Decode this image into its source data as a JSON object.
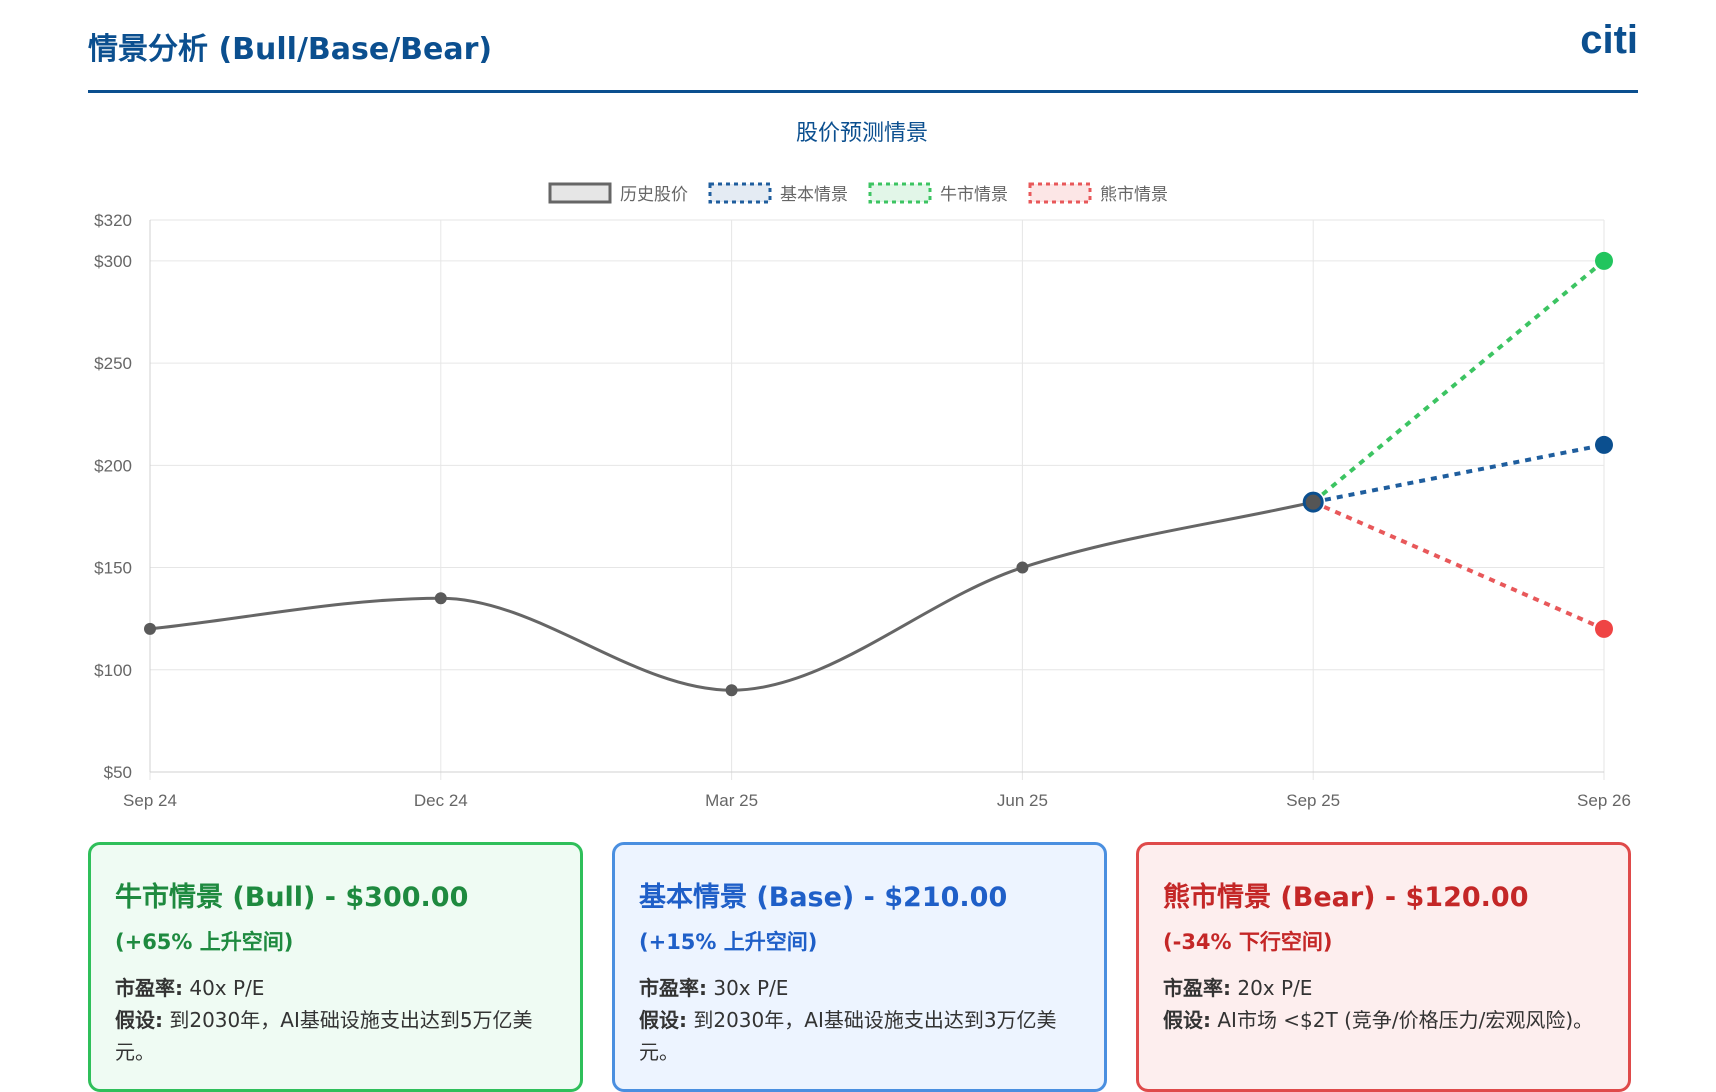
{
  "header": {
    "title": "情景分析 (Bull/Base/Bear)",
    "brand": "citi"
  },
  "colors": {
    "history": "#666666",
    "base": "#1f5e9e",
    "bull": "#3cc462",
    "bear": "#e8585a",
    "base_point": "#0b4f8f",
    "bull_point": "#22c55e",
    "bear_point": "#ef4444"
  },
  "chart_data": {
    "type": "line",
    "title": "股价预测情景",
    "legend_position": "top",
    "grid": true,
    "x": [
      "Sep 24",
      "Dec 24",
      "Mar 25",
      "Jun 25",
      "Sep 25",
      "Sep 26"
    ],
    "ylim": [
      50,
      320
    ],
    "yticks": [
      50,
      100,
      150,
      200,
      250,
      300,
      320
    ],
    "ytick_labels": [
      "$50",
      "$100",
      "$150",
      "$200",
      "$250",
      "$300",
      "$320"
    ],
    "series": [
      {
        "name": "历史股价",
        "style": "solid",
        "values": [
          120,
          135,
          90,
          150,
          182,
          null
        ]
      },
      {
        "name": "基本情景",
        "style": "dashed",
        "values": [
          null,
          null,
          null,
          null,
          182,
          210
        ]
      },
      {
        "name": "牛市情景",
        "style": "dashed",
        "values": [
          null,
          null,
          null,
          null,
          182,
          300
        ]
      },
      {
        "name": "熊市情景",
        "style": "dashed",
        "values": [
          null,
          null,
          null,
          null,
          182,
          120
        ]
      }
    ]
  },
  "cards": {
    "bull": {
      "title": "牛市情景 (Bull) - $300.00",
      "sub": "(+65% 上升空间)",
      "pe_label": "市盈率:",
      "pe_value": "40x P/E",
      "assume_label": "假设:",
      "assume_value": "到2030年，AI基础设施支出达到5万亿美元。"
    },
    "base": {
      "title": "基本情景 (Base) - $210.00",
      "sub": "(+15% 上升空间)",
      "pe_label": "市盈率:",
      "pe_value": "30x P/E",
      "assume_label": "假设:",
      "assume_value": "到2030年，AI基础设施支出达到3万亿美元。"
    },
    "bear": {
      "title": "熊市情景 (Bear) - $120.00",
      "sub": "(-34% 下行空间)",
      "pe_label": "市盈率:",
      "pe_value": "20x P/E",
      "assume_label": "假设:",
      "assume_value": "AI市场 <$2T (竞争/价格压力/宏观风险)。"
    }
  }
}
